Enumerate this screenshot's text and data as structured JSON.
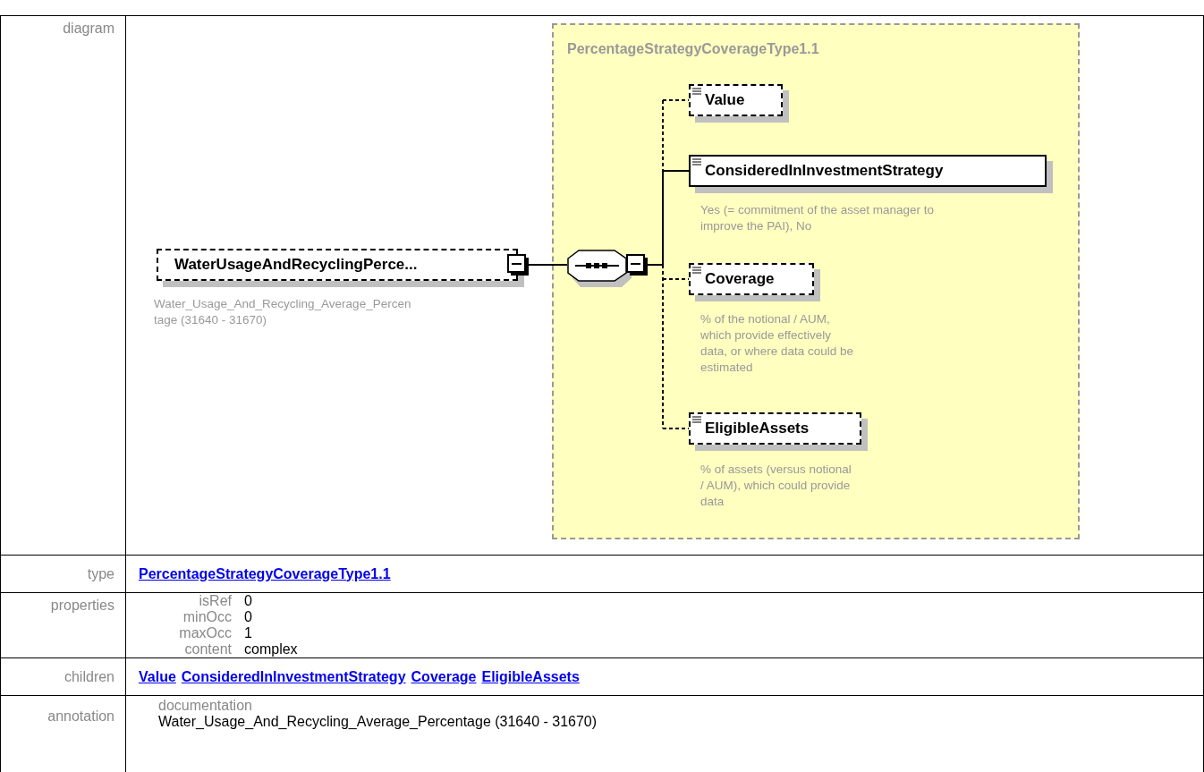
{
  "diagram": {
    "label": "diagram",
    "root": {
      "name": "WaterUsageAndRecyclingPerce...",
      "optional": true,
      "expanded": true,
      "caption": "Water_Usage_And_Recycling_Average_Percen\ntage (31640 - 31670)"
    },
    "sequence": {
      "expanded": true
    },
    "complex_type": {
      "title": "PercentageStrategyCoverageType1.1",
      "children": [
        {
          "name": "Value",
          "optional": true
        },
        {
          "name": "ConsideredInInvestmentStrategy",
          "optional": false,
          "description": "Yes (= commitment of the asset manager to\nimprove the PAI), No"
        },
        {
          "name": "Coverage",
          "optional": true,
          "description": "% of the notional / AUM,\nwhich provide effectively\ndata, or where data could be\nestimated"
        },
        {
          "name": "EligibleAssets",
          "optional": true,
          "description": "% of assets (versus notional\n/ AUM), which could provide\ndata"
        }
      ]
    }
  },
  "type": {
    "label": "type",
    "link": "PercentageStrategyCoverageType1.1"
  },
  "properties": {
    "label": "properties",
    "items": [
      {
        "key": "isRef",
        "value": "0"
      },
      {
        "key": "minOcc",
        "value": "0"
      },
      {
        "key": "maxOcc",
        "value": "1"
      },
      {
        "key": "content",
        "value": "complex"
      }
    ]
  },
  "children": {
    "label": "children",
    "links": [
      "Value",
      "ConsideredInInvestmentStrategy",
      "Coverage",
      "EligibleAssets"
    ]
  },
  "annotation": {
    "label": "annotation",
    "heading": "documentation",
    "text": "Water_Usage_And_Recycling_Average_Percentage (31640 - 31670)"
  }
}
